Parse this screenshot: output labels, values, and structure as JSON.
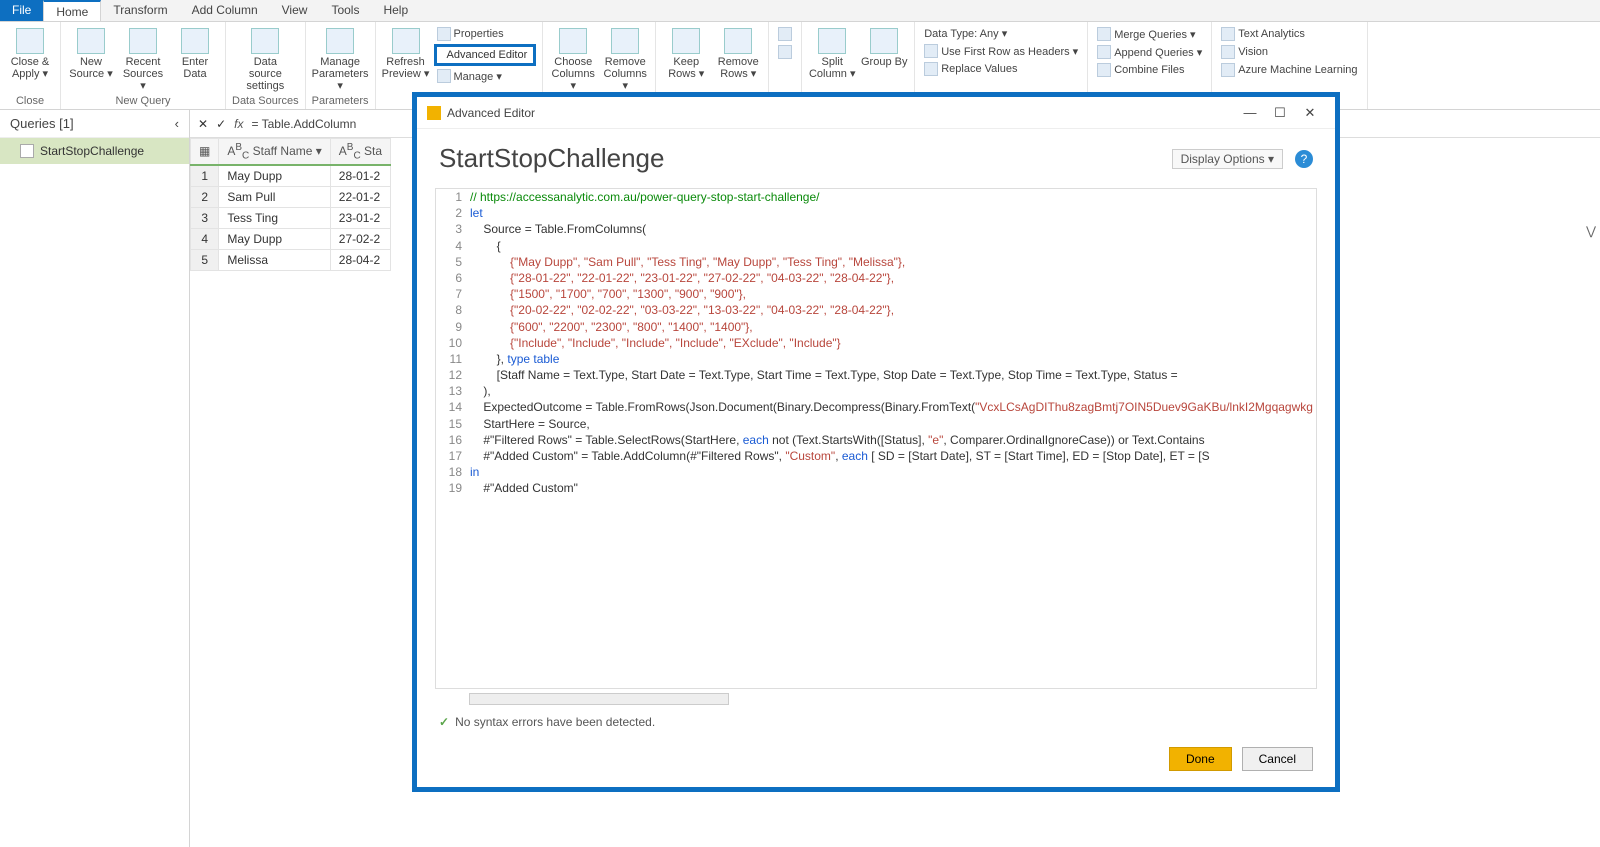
{
  "tabs": {
    "file": "File",
    "home": "Home",
    "transform": "Transform",
    "addcol": "Add Column",
    "view": "View",
    "tools": "Tools",
    "help": "Help"
  },
  "ribbon": {
    "close_apply": "Close & Apply ▾",
    "close_lbl": "Close",
    "new_source": "New Source ▾",
    "recent_sources": "Recent Sources ▾",
    "enter_data": "Enter Data",
    "new_query_lbl": "New Query",
    "data_source_settings": "Data source settings",
    "data_sources_lbl": "Data Sources",
    "manage_params": "Manage Parameters ▾",
    "params_lbl": "Parameters",
    "refresh": "Refresh Preview ▾",
    "properties": "Properties",
    "advanced_editor": "Advanced Editor",
    "manage": "Manage ▾",
    "choose_cols": "Choose Columns ▾",
    "remove_cols": "Remove Columns ▾",
    "keep_rows": "Keep Rows ▾",
    "remove_rows": "Remove Rows ▾",
    "split_col": "Split Column ▾",
    "group_by": "Group By",
    "data_type": "Data Type: Any ▾",
    "first_row": "Use First Row as Headers ▾",
    "replace_vals": "Replace Values",
    "merge_q": "Merge Queries ▾",
    "append_q": "Append Queries ▾",
    "combine_files": "Combine Files",
    "text_analytics": "Text Analytics",
    "vision": "Vision",
    "azure_ml": "Azure Machine Learning"
  },
  "queries": {
    "title": "Queries [1]",
    "item1": "StartStopChallenge"
  },
  "formula": "= Table.AddColumn",
  "grid": {
    "colA": "Staff Name",
    "colB_prefix": "Sta",
    "rows": [
      {
        "n": "1",
        "name": "May Dupp",
        "date": "28-01-2"
      },
      {
        "n": "2",
        "name": "Sam Pull",
        "date": "22-01-2"
      },
      {
        "n": "3",
        "name": "Tess Ting",
        "date": "23-01-2"
      },
      {
        "n": "4",
        "name": "May Dupp",
        "date": "27-02-2"
      },
      {
        "n": "5",
        "name": "Melissa",
        "date": "28-04-2"
      }
    ]
  },
  "dialog": {
    "title": "Advanced Editor",
    "heading": "StartStopChallenge",
    "display_options": "Display Options ▾",
    "status": "No syntax errors have been detected.",
    "done": "Done",
    "cancel": "Cancel"
  },
  "code": {
    "l1a": "// https://accessanalytic.com.au/power-query-stop-start-challenge/",
    "l2a": "let",
    "l3a": "    Source = Table.FromColumns(",
    "l4a": "        {",
    "l5a": "            {\"May Dupp\", \"Sam Pull\", \"Tess Ting\", \"May Dupp\", \"Tess Ting\", \"Melissa\"},",
    "l6a": "            {\"28-01-22\", \"22-01-22\", \"23-01-22\", \"27-02-22\", \"04-03-22\", \"28-04-22\"},",
    "l7a": "            {\"1500\", \"1700\", \"700\", \"1300\", \"900\", \"900\"},",
    "l8a": "            {\"20-02-22\", \"02-02-22\", \"03-03-22\", \"13-03-22\", \"04-03-22\", \"28-04-22\"},",
    "l9a": "            {\"600\", \"2200\", \"2300\", \"800\", \"1400\", \"1400\"},",
    "l10a": "            {\"Include\", \"Include\", \"Include\", \"Include\", \"EXclude\", \"Include\"}",
    "l11a": "        }, ",
    "l11b": "type ",
    "l11c": "table",
    "l12a": "        [Staff Name = Text.Type, Start Date = Text.Type, Start Time = Text.Type, Stop Date = Text.Type, Stop Time = Text.Type, Status =",
    "l13a": "    ),",
    "l14a": "    ExpectedOutcome = Table.FromRows(Json.Document(Binary.Decompress(Binary.FromText(",
    "l14b": "\"VcxLCsAgDIThu8zagBmtj7OIN5Duev9GaKBu/lnkI2Mgqagwkg",
    "l15a": "    StartHere = Source,",
    "l16a": "    #\"Filtered Rows\" = Table.SelectRows(StartHere, ",
    "l16b": "each",
    "l16c": " not (Text.StartsWith([Status], ",
    "l16d": "\"e\"",
    "l16e": ", Comparer.OrdinalIgnoreCase)) or Text.Contains",
    "l17a": "    #\"Added Custom\" = Table.AddColumn(#\"Filtered Rows\", ",
    "l17b": "\"Custom\"",
    "l17c": ", ",
    "l17d": "each",
    "l17e": " [ SD = [Start Date], ST = [Start Time], ED = [Stop Date], ET = [S",
    "l18a": "in",
    "l19a": "    #\"Added Custom\""
  }
}
